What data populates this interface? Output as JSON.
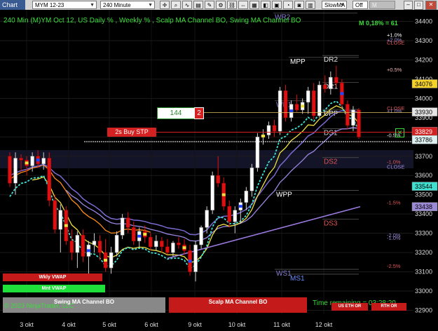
{
  "toolbar": {
    "chart_tab": "Chart",
    "instrument": "MYM 12-23",
    "interval": "240 Minute",
    "indicator_select": "SlowMA",
    "off_toggle": "Off",
    "vwap_button": "M VWAP"
  },
  "header": {
    "title": "240 Min (M)YM Oct 12, US Daily % , Weekly % , Scalp MA Channel BO, Swing MA Channel BO",
    "stat": "M 0,18% = 61"
  },
  "order_widget": {
    "quantity": "144",
    "count": "2",
    "order_label": "2s Buy STP"
  },
  "price_axis": {
    "ticks": [
      "34400",
      "34300",
      "34200",
      "34100",
      "34000",
      "33900",
      "33800",
      "33700",
      "33600",
      "33500",
      "33400",
      "33300",
      "33200",
      "33100",
      "33000",
      "32900"
    ],
    "badges": [
      {
        "text": "34076",
        "price": 34076,
        "bg": "#f4d22a",
        "fg": "#000"
      },
      {
        "text": "33930",
        "price": 33930,
        "bg": "#e6e6e6",
        "fg": "#000"
      },
      {
        "text": "33829",
        "price": 33829,
        "bg": "#d32020",
        "fg": "#fff"
      },
      {
        "text": "33786",
        "price": 33786,
        "bg": "#dff2f2",
        "fg": "#000"
      },
      {
        "text": "33544",
        "price": 33544,
        "bg": "#40e0d0",
        "fg": "#000"
      },
      {
        "text": "33438",
        "price": 33438,
        "bg": "#9c8ad6",
        "fg": "#000"
      }
    ]
  },
  "levels": [
    {
      "text": "WR2",
      "price": 34410,
      "color": "#8a7fd6"
    },
    {
      "text": "MPP",
      "price": 34180,
      "color": "#ffffff"
    },
    {
      "text": "DR2",
      "price": 34190,
      "color": "#e0e0e0"
    },
    {
      "text": "DR1",
      "price": 34050,
      "color": "#e0e0e0"
    },
    {
      "text": "WR1",
      "price": 33955,
      "color": "#8a7fd6"
    },
    {
      "text": "DPP",
      "price": 33910,
      "color": "#ffffff"
    },
    {
      "text": "DS1",
      "price": 33810,
      "color": "#d0d0d0"
    },
    {
      "text": "DS2",
      "price": 33660,
      "color": "#e05555"
    },
    {
      "text": "WPP",
      "price": 33490,
      "color": "#ffffff"
    },
    {
      "text": "DS3",
      "price": 33340,
      "color": "#e05555"
    },
    {
      "text": "WS1",
      "price": 33080,
      "color": "#8a7fd6"
    },
    {
      "text": "MS1",
      "price": 33055,
      "color": "#6a8cff"
    }
  ],
  "pct_labels": [
    {
      "text": "+1.0%",
      "price": 34320,
      "color": "#ffffff"
    },
    {
      "text": "+2.0%",
      "price": 34295,
      "color": "#9c8ad6"
    },
    {
      "text": "CLOSE",
      "price": 34280,
      "color": "#e05555"
    },
    {
      "text": "+0.5%",
      "price": 34140,
      "color": "#e8b0b0"
    },
    {
      "text": "CLOSE",
      "price": 33940,
      "color": "#e05555"
    },
    {
      "text": "+1.0%",
      "price": 33925,
      "color": "#9c8ad6"
    },
    {
      "text": "-0.5%",
      "price": 33800,
      "color": "#e0e0e0"
    },
    {
      "text": "-1.0%",
      "price": 33660,
      "color": "#e05555"
    },
    {
      "text": "CLOSE",
      "price": 33635,
      "color": "#9c8ad6"
    },
    {
      "text": "-1.5%",
      "price": 33450,
      "color": "#e05555"
    },
    {
      "text": "-2.0%",
      "price": 33280,
      "color": "#9c8ad6"
    },
    {
      "text": "-1.0%",
      "price": 33265,
      "color": "#9c8ad6"
    },
    {
      "text": "-2.5%",
      "price": 33120,
      "color": "#e05555"
    }
  ],
  "date_axis": {
    "labels": [
      "3 okt",
      "4 okt",
      "5 okt",
      "6 okt",
      "9 okt",
      "10 okt",
      "11 okt",
      "12 okt"
    ]
  },
  "legend": {
    "wkly_vwap": "Wkly VWAP",
    "mnt_vwap": "Mnt VWAP",
    "swing_bo": "Swing MA Channel BO",
    "scalp_bo": "Scalp MA Channel BO",
    "copyright": "© 2023 NinjaTrader, LLC",
    "time_remaining": "Time remaining = 03:28:20",
    "us_eth_or": "US ETH OR",
    "rth_or": "RTH OR"
  },
  "colors": {
    "bull": "#ffffff",
    "bear": "#dd1111",
    "fast_ma": "#f0e040",
    "slow_ma": "#7a6ad0",
    "swing_ma": "#ff8c1a",
    "channel": "#40e0d0",
    "trend": "#9a7ae0"
  },
  "chart_data": {
    "type": "candlestick",
    "price_range": [
      32880,
      34460
    ],
    "candles": [
      [
        33700,
        33720,
        33540,
        33560
      ],
      [
        33560,
        33720,
        33500,
        33690
      ],
      [
        33690,
        33710,
        33620,
        33680
      ],
      [
        33680,
        33700,
        33600,
        33650
      ],
      [
        33650,
        33720,
        33620,
        33700
      ],
      [
        33700,
        33730,
        33640,
        33660
      ],
      [
        33660,
        33720,
        33630,
        33690
      ],
      [
        33690,
        33720,
        33440,
        33470
      ],
      [
        33470,
        33500,
        33300,
        33320
      ],
      [
        33320,
        33450,
        33200,
        33420
      ],
      [
        33420,
        33440,
        33240,
        33260
      ],
      [
        33260,
        33320,
        33160,
        33200
      ],
      [
        33200,
        33310,
        33120,
        33290
      ],
      [
        33290,
        33320,
        33150,
        33180
      ],
      [
        33180,
        33260,
        33080,
        33240
      ],
      [
        33240,
        33300,
        33200,
        33260
      ],
      [
        33260,
        33290,
        33160,
        33200
      ],
      [
        33200,
        33270,
        33100,
        33120
      ],
      [
        33120,
        33230,
        33090,
        33200
      ],
      [
        33200,
        33310,
        33180,
        33290
      ],
      [
        33290,
        33400,
        33270,
        33380
      ],
      [
        33380,
        33410,
        33300,
        33330
      ],
      [
        33330,
        33360,
        33240,
        33260
      ],
      [
        33260,
        33330,
        33230,
        33310
      ],
      [
        33310,
        33340,
        33250,
        33280
      ],
      [
        33280,
        33300,
        33210,
        33230
      ],
      [
        33230,
        33290,
        33210,
        33260
      ],
      [
        33260,
        33280,
        33200,
        33230
      ],
      [
        33230,
        33270,
        33190,
        33200
      ],
      [
        33200,
        33260,
        33180,
        33250
      ],
      [
        33250,
        33280,
        33220,
        33240
      ],
      [
        33240,
        33270,
        33190,
        33210
      ],
      [
        33210,
        33240,
        33080,
        33100
      ],
      [
        33100,
        33260,
        33050,
        33240
      ],
      [
        33240,
        33340,
        33220,
        33330
      ],
      [
        33330,
        33440,
        33300,
        33420
      ],
      [
        33420,
        33620,
        33400,
        33600
      ],
      [
        33600,
        33700,
        33540,
        33560
      ],
      [
        33560,
        33590,
        33420,
        33440
      ],
      [
        33440,
        33470,
        33330,
        33360
      ],
      [
        33360,
        33440,
        33300,
        33420
      ],
      [
        33420,
        33480,
        33350,
        33460
      ],
      [
        33460,
        33540,
        33420,
        33520
      ],
      [
        33520,
        33660,
        33490,
        33640
      ],
      [
        33640,
        33820,
        33620,
        33800
      ],
      [
        33800,
        33840,
        33760,
        33810
      ],
      [
        33810,
        33880,
        33790,
        33860
      ],
      [
        33860,
        33890,
        33800,
        33830
      ],
      [
        33830,
        34060,
        33810,
        34040
      ],
      [
        34040,
        34070,
        33880,
        33900
      ],
      [
        33900,
        33990,
        33880,
        33970
      ],
      [
        33970,
        34020,
        33930,
        33940
      ],
      [
        33940,
        34000,
        33920,
        33980
      ],
      [
        33980,
        34060,
        33920,
        34040
      ],
      [
        34040,
        34080,
        33890,
        33910
      ],
      [
        33910,
        34090,
        33900,
        34070
      ],
      [
        34070,
        34120,
        34030,
        34050
      ],
      [
        34050,
        34140,
        34020,
        34110
      ],
      [
        34110,
        34170,
        34060,
        34080
      ],
      [
        34080,
        34100,
        33950,
        33970
      ],
      [
        33970,
        33990,
        33840,
        33860
      ],
      [
        33860,
        33960,
        33830,
        33940
      ],
      [
        33940,
        33950,
        33790,
        33800
      ]
    ]
  }
}
